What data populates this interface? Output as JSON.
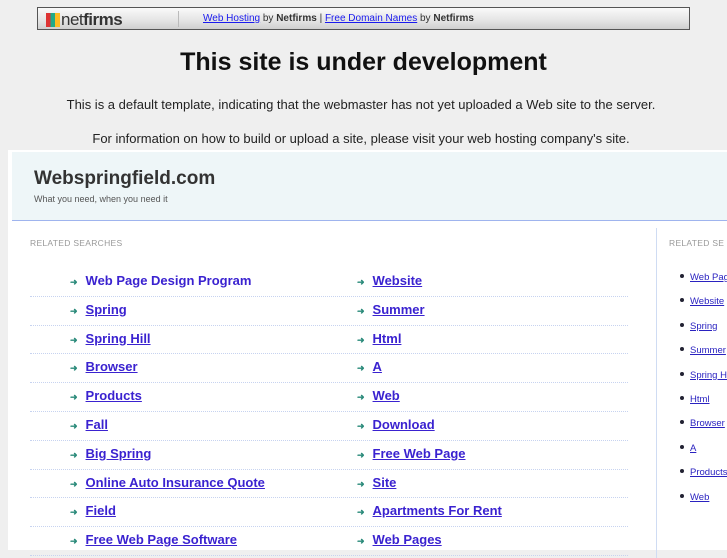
{
  "topbar": {
    "logo": "netfirms",
    "link1": "Web Hosting",
    "by1": "by",
    "brand1": "Netfirms",
    "pipe": "|",
    "link2": "Free Domain Names",
    "by2": "by",
    "brand2": "Netfirms"
  },
  "title": "This site is under development",
  "message1": "This is a default template, indicating that the webmaster has not yet uploaded a Web site to the server.",
  "message2": "For information on how to build or upload a site, please visit your web hosting company's site.",
  "site": {
    "name": "Webspringfield.com",
    "tagline": "What you need, when you need it"
  },
  "related_label": "RELATED SEARCHES",
  "related_label_right": "RELATED SE",
  "left_items": [
    [
      "Web Page Design Program",
      "Website"
    ],
    [
      "Spring",
      "Summer"
    ],
    [
      "Spring Hill",
      "Html"
    ],
    [
      "Browser",
      "A"
    ],
    [
      "Products",
      "Web"
    ],
    [
      "Fall",
      "Download"
    ],
    [
      "Big Spring",
      "Free Web Page"
    ],
    [
      "Online Auto Insurance Quote",
      "Site"
    ],
    [
      "Field",
      "Apartments For Rent"
    ],
    [
      "Free Web Page Software",
      "Web Pages"
    ]
  ],
  "right_items": [
    "Web Page Design Program",
    "Website",
    "Spring",
    "Summer",
    "Spring Hill",
    "Html",
    "Browser",
    "A",
    "Products",
    "Web"
  ]
}
